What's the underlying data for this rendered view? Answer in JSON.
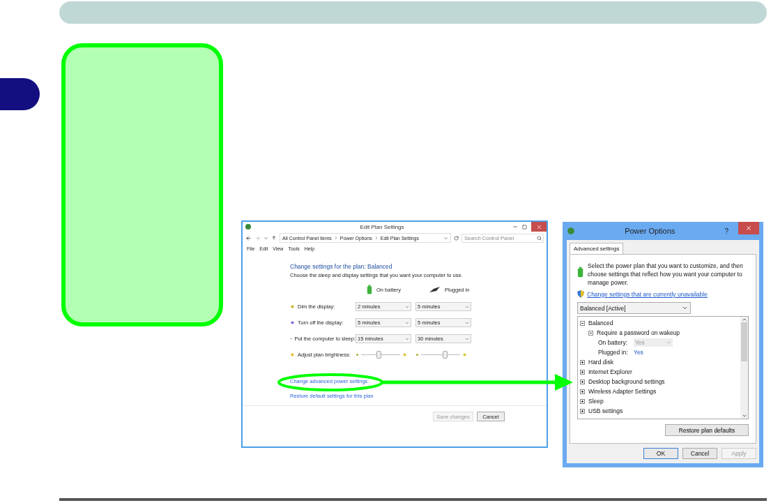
{
  "edit_plan_window": {
    "title": "Edit Plan Settings",
    "breadcrumb": [
      "All Control Panel items",
      "Power Options",
      "Edit Plan Settings"
    ],
    "search": {
      "placeholder": "Search Control Panel"
    },
    "menu": [
      "File",
      "Edit",
      "View",
      "Tools",
      "Help"
    ],
    "heading": "Change settings for the plan: Balanced",
    "subheading": "Choose the sleep and display settings that you want your computer to use.",
    "columns": [
      "On battery",
      "Plugged in"
    ],
    "settings": [
      {
        "kind": "select",
        "label": "Dim the display:",
        "values": [
          "2 minutes",
          "5 minutes"
        ]
      },
      {
        "kind": "select",
        "label": "Turn off the display:",
        "values": [
          "5 minutes",
          "5 minutes"
        ]
      },
      {
        "kind": "select",
        "label": "Put the computer to sleep:",
        "values": [
          "15 minutes",
          "30 minutes"
        ]
      },
      {
        "kind": "slider",
        "label": "Adjust plan brightness:",
        "sliders": [
          {
            "level": 0.45
          },
          {
            "level": 0.6
          }
        ]
      }
    ],
    "links": [
      "Change advanced power settings",
      "Restore default settings for this plan"
    ],
    "buttons": [
      {
        "label": "Save changes",
        "disabled": true
      },
      {
        "label": "Cancel",
        "disabled": false
      }
    ]
  },
  "power_options": {
    "title": "Power Options",
    "help_button": "?",
    "tabs": [
      {
        "label": "Advanced settings",
        "selected": true
      }
    ],
    "description": "Select the power plan that you want to customize, and then choose settings that reflect how you want your computer to manage power.",
    "link": "Change settings that are currently unavailable",
    "plan_select": "Balanced [Active]",
    "tree": [
      {
        "label": "Balanced",
        "expanded": true,
        "children": [
          {
            "label": "Require a password on wakeup",
            "expanded": true,
            "children": [
              {
                "kind": "select",
                "label": "On battery:",
                "value": "Yes"
              },
              {
                "kind": "value",
                "label": "Plugged in:",
                "value": "Yes"
              }
            ]
          }
        ]
      },
      {
        "label": "Hard disk",
        "expanded": false
      },
      {
        "label": "Internet Explorer",
        "expanded": false
      },
      {
        "label": "Desktop background settings",
        "expanded": false
      },
      {
        "label": "Wireless Adapter Settings",
        "expanded": false
      },
      {
        "label": "Sleep",
        "expanded": false
      },
      {
        "label": "USB settings",
        "expanded": false
      }
    ],
    "restore_button": "Restore plan defaults",
    "buttons": [
      {
        "label": "OK",
        "disabled": false
      },
      {
        "label": "Cancel",
        "disabled": false
      },
      {
        "label": "Apply",
        "disabled": true
      }
    ]
  }
}
